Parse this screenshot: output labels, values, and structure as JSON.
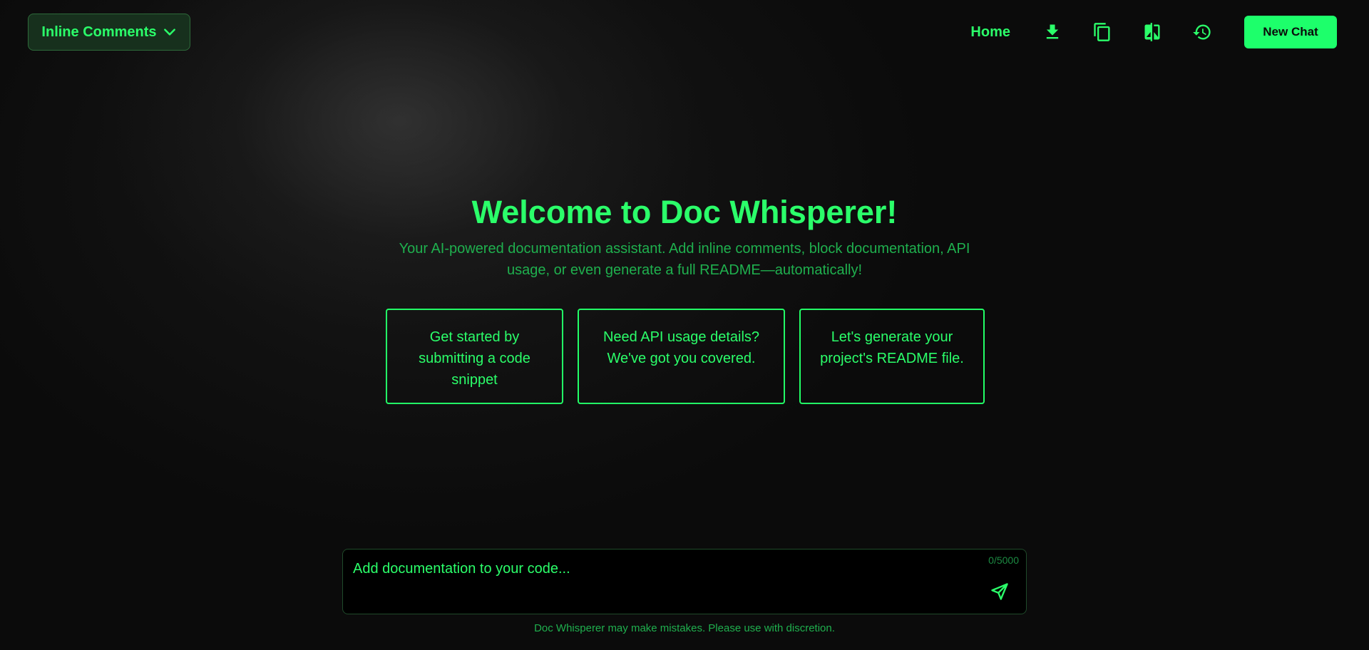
{
  "header": {
    "mode_label": "Inline Comments",
    "home_label": "Home",
    "icons": [
      "download-icon",
      "copy-icon",
      "compare-icon",
      "history-icon"
    ],
    "new_chat_label": "New Chat"
  },
  "hero": {
    "title": "Welcome to Doc Whisperer!",
    "subtitle": "Your AI-powered documentation assistant. Add inline comments, block documentation, API usage, or even generate a full README—automatically!"
  },
  "cards": [
    {
      "label": "Get started by submitting a code snippet"
    },
    {
      "label": "Need API usage details? We've got you covered."
    },
    {
      "label": "Let's generate your project's README file."
    }
  ],
  "composer": {
    "placeholder": "Add documentation to your code...",
    "value": "",
    "counter": "0/5000"
  },
  "footer": {
    "disclaimer": "Doc Whisperer may make mistakes. Please use with discretion."
  },
  "colors": {
    "accent": "#22ff66",
    "background": "#0b0b0b",
    "muted_accent": "#1fb04e"
  }
}
